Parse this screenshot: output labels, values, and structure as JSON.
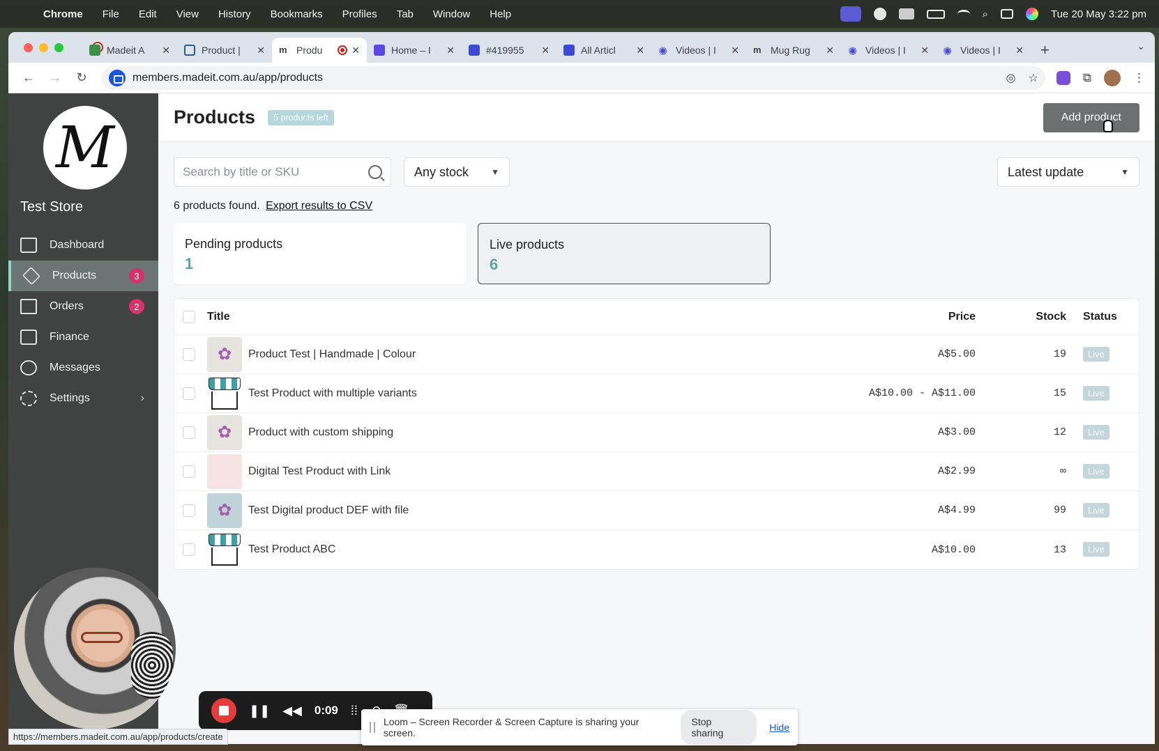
{
  "menubar": {
    "app": "Chrome",
    "items": [
      "File",
      "Edit",
      "View",
      "History",
      "Bookmarks",
      "Profiles",
      "Tab",
      "Window",
      "Help"
    ],
    "clock": "Tue 20 May  3:22 pm"
  },
  "browser": {
    "tabs": [
      {
        "label": "Madeit A",
        "icon": "madeit-icon"
      },
      {
        "label": "Product |",
        "icon": "product-icon"
      },
      {
        "label": "Produ",
        "icon": "madeit-icon",
        "active": true
      },
      {
        "label": "Home – I",
        "icon": "s-icon"
      },
      {
        "label": "#419955",
        "icon": "slash-icon"
      },
      {
        "label": "All Articl",
        "icon": "slash-icon"
      },
      {
        "label": "Videos | I",
        "icon": "gear-icon"
      },
      {
        "label": "Mug Rug",
        "icon": "madeit-icon"
      },
      {
        "label": "Videos | I",
        "icon": "gear-icon"
      },
      {
        "label": "Videos | I",
        "icon": "gear-icon"
      }
    ],
    "url": "members.madeit.com.au/app/products",
    "status_url": "https://members.madeit.com.au/app/products/create"
  },
  "sidebar": {
    "store_name": "Test Store",
    "items": [
      {
        "label": "Dashboard",
        "icon": "home-icon"
      },
      {
        "label": "Products",
        "icon": "layers-icon",
        "badge": "3",
        "active": true
      },
      {
        "label": "Orders",
        "icon": "book-icon",
        "badge": "2"
      },
      {
        "label": "Finance",
        "icon": "money-icon"
      },
      {
        "label": "Messages",
        "icon": "chat-icon"
      },
      {
        "label": "Settings",
        "icon": "settings-icon",
        "chevron": true
      }
    ]
  },
  "header": {
    "title": "Products",
    "badge": "5 products left",
    "add_button": "Add product"
  },
  "filters": {
    "search_placeholder": "Search by title or SKU",
    "stock": "Any stock",
    "sort": "Latest update"
  },
  "results": {
    "count_text": "6 products found.",
    "export_link": "Export results to CSV"
  },
  "cards": [
    {
      "label": "Pending products",
      "count": "1"
    },
    {
      "label": "Live products",
      "count": "6",
      "selected": true
    }
  ],
  "table": {
    "headers": {
      "title": "Title",
      "price": "Price",
      "stock": "Stock",
      "status": "Status"
    },
    "rows": [
      {
        "title": "Product Test | Handmade | Colour",
        "price": "A$5.00",
        "stock": "19",
        "status": "Live",
        "thumb": "flower"
      },
      {
        "title": "Test Product with multiple variants",
        "price": "A$10.00 - A$11.00",
        "stock": "15",
        "status": "Live",
        "thumb": "stall"
      },
      {
        "title": "Product with custom shipping",
        "price": "A$3.00",
        "stock": "12",
        "status": "Live",
        "thumb": "flower"
      },
      {
        "title": "Digital Test Product with Link",
        "price": "A$2.99",
        "stock": "∞",
        "status": "Live",
        "thumb": "pink"
      },
      {
        "title": "Test Digital product DEF with file",
        "price": "A$4.99",
        "stock": "99",
        "status": "Live",
        "thumb": "teal"
      },
      {
        "title": "Test Product ABC",
        "price": "A$10.00",
        "stock": "13",
        "status": "Live",
        "thumb": "stall"
      }
    ]
  },
  "recorder": {
    "time": "0:09"
  },
  "share_bar": {
    "message": "Loom – Screen Recorder & Screen Capture is sharing your screen.",
    "stop_label": "Stop sharing",
    "hide_label": "Hide"
  }
}
